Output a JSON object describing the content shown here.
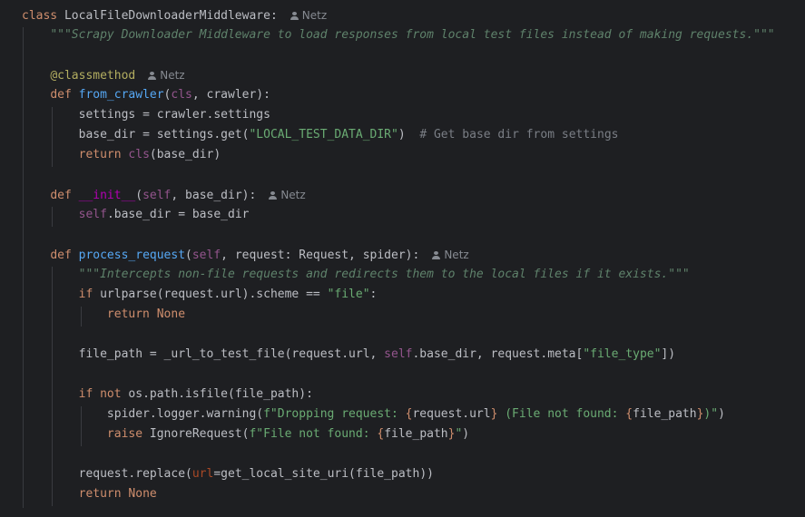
{
  "author_hint": "Netz",
  "colors": {
    "background": "#1e1f22",
    "keyword": "#cf8e6d",
    "function": "#56a8f5",
    "string": "#6aab73",
    "docstring": "#5f826b",
    "comment": "#7a7e85",
    "self": "#94558d",
    "decorator": "#b3ae60"
  },
  "code": {
    "l1": {
      "kw": "class",
      "name": "LocalFileDownloaderMiddleware:"
    },
    "l2": {
      "doc": "\"\"\"Scrapy Downloader Middleware to load responses from local test files instead of making requests.\"\"\""
    },
    "l4": {
      "dec": "@classmethod"
    },
    "l5": {
      "kw": "def",
      "fn": "from_crawler",
      "a": "(",
      "cls": "cls",
      "b": ", crawler):"
    },
    "l6": {
      "text": "settings = crawler.settings"
    },
    "l7": {
      "a": "base_dir = settings.get(",
      "str": "\"LOCAL_TEST_DATA_DIR\"",
      "b": ")  ",
      "cmt": "# Get base dir from settings"
    },
    "l8": {
      "kw": "return",
      "cls": "cls",
      "b": "(base_dir)"
    },
    "l10": {
      "kw": "def",
      "fn": "__init__",
      "a": "(",
      "self": "self",
      "b": ", base_dir):"
    },
    "l11": {
      "self": "self",
      "b": ".base_dir = base_dir"
    },
    "l13": {
      "kw": "def",
      "fn": "process_request",
      "a": "(",
      "self": "self",
      "b": ", request: Request, spider):"
    },
    "l14": {
      "doc": "\"\"\"Intercepts non-file requests and redirects them to the local files if it exists.\"\"\""
    },
    "l15": {
      "kw": "if",
      "a": "urlparse(request.url).scheme == ",
      "str": "\"file\"",
      "b": ":"
    },
    "l16": {
      "kw": "return",
      "kw2": "None"
    },
    "l18": {
      "a": "file_path = _url_to_test_file(request.url, ",
      "self": "self",
      "b": ".base_dir, request.meta[",
      "str": "\"file_type\"",
      "c": "])"
    },
    "l20": {
      "kw": "if",
      "kw2": "not",
      "a": "os.path.isfile(file_path):"
    },
    "l21": {
      "a": "spider.logger.warning(",
      "s1": "f\"Dropping request: ",
      "br1": "{",
      "e1": "request.url",
      "br2": "}",
      "s2": " (File not found: ",
      "br3": "{",
      "e2": "file_path",
      "br4": "}",
      "s3": ")\"",
      "c": ")"
    },
    "l22": {
      "kw": "raise",
      "a": "IgnoreRequest(",
      "s1": "f\"File not found: ",
      "br1": "{",
      "e1": "file_path",
      "br2": "}",
      "s2": "\"",
      "c": ")"
    },
    "l24": {
      "a": "request.replace(",
      "kwarg": "url",
      "b": "=get_local_site_uri(file_path))"
    },
    "l25": {
      "kw": "return",
      "kw2": "None"
    }
  }
}
